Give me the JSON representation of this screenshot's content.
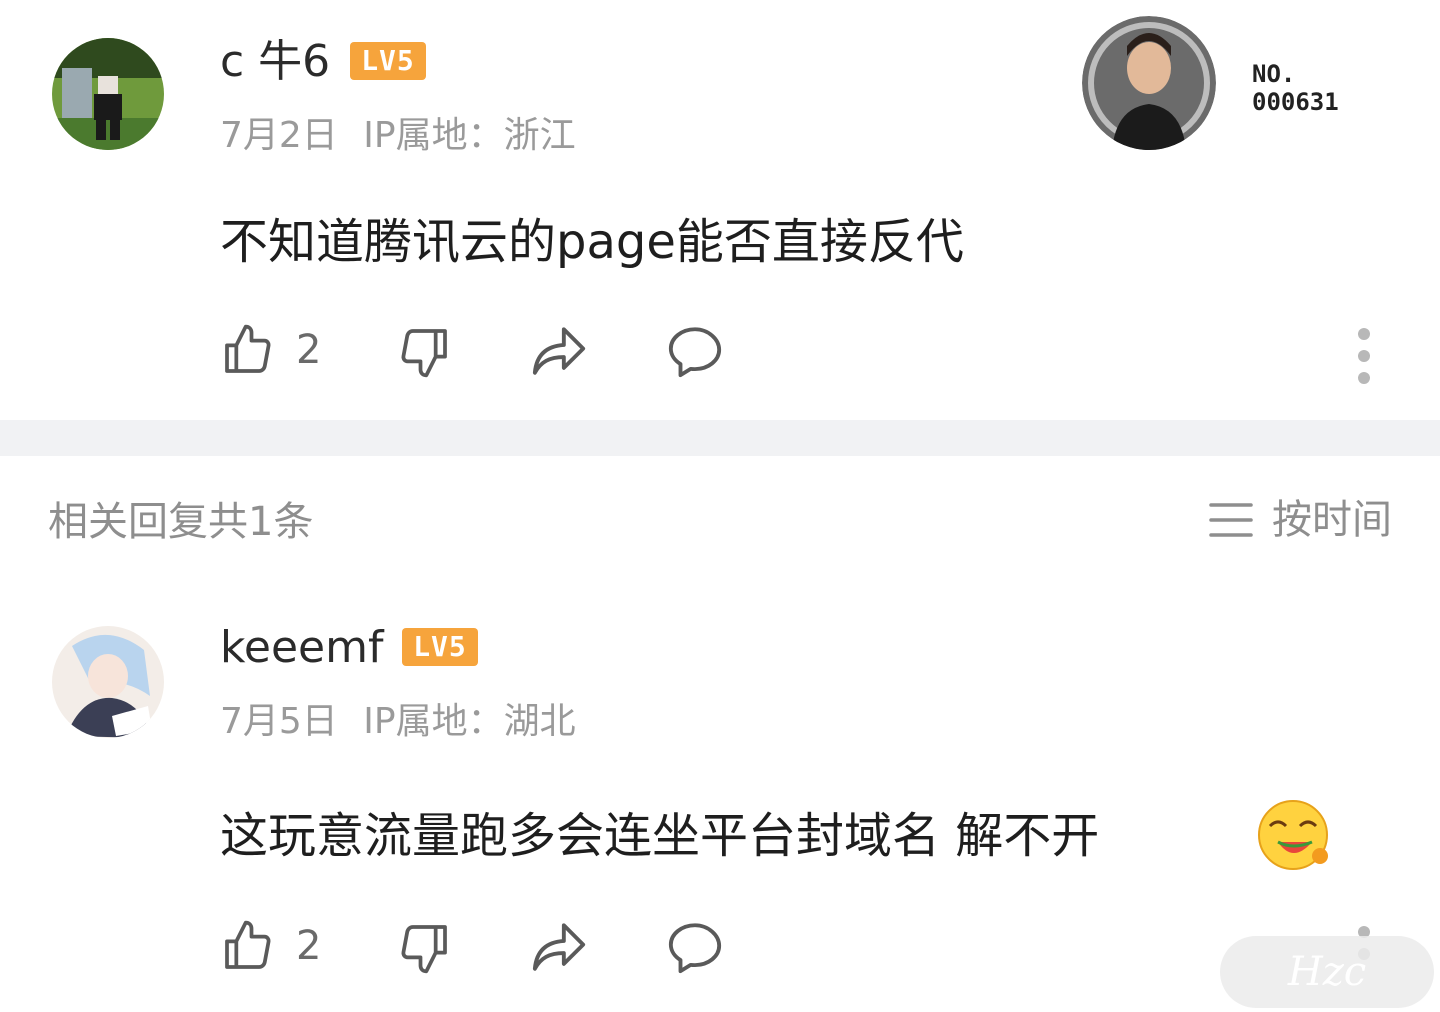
{
  "comments": [
    {
      "username": "c 牛6",
      "level_badge": "LV5",
      "date": "7月2日",
      "ip_label": "IP属地：浙江",
      "text": "不知道腾讯云的page能否直接反代",
      "likes": "2"
    },
    {
      "username": "keeemf",
      "level_badge": "LV5",
      "date": "7月5日",
      "ip_label": "IP属地：湖北",
      "text": "这玩意流量跑多会连坐平台封域名 解不开",
      "likes": "2"
    }
  ],
  "medal": {
    "number_prefix": "NO.",
    "number": "000631"
  },
  "replies": {
    "header": "相关回复共1条",
    "sort_label": "按时间"
  },
  "watermark": "Hzc",
  "colors": {
    "level_badge": "#f6a43c",
    "divider": "#f1f2f4",
    "meta_text": "#9a9a9a"
  }
}
